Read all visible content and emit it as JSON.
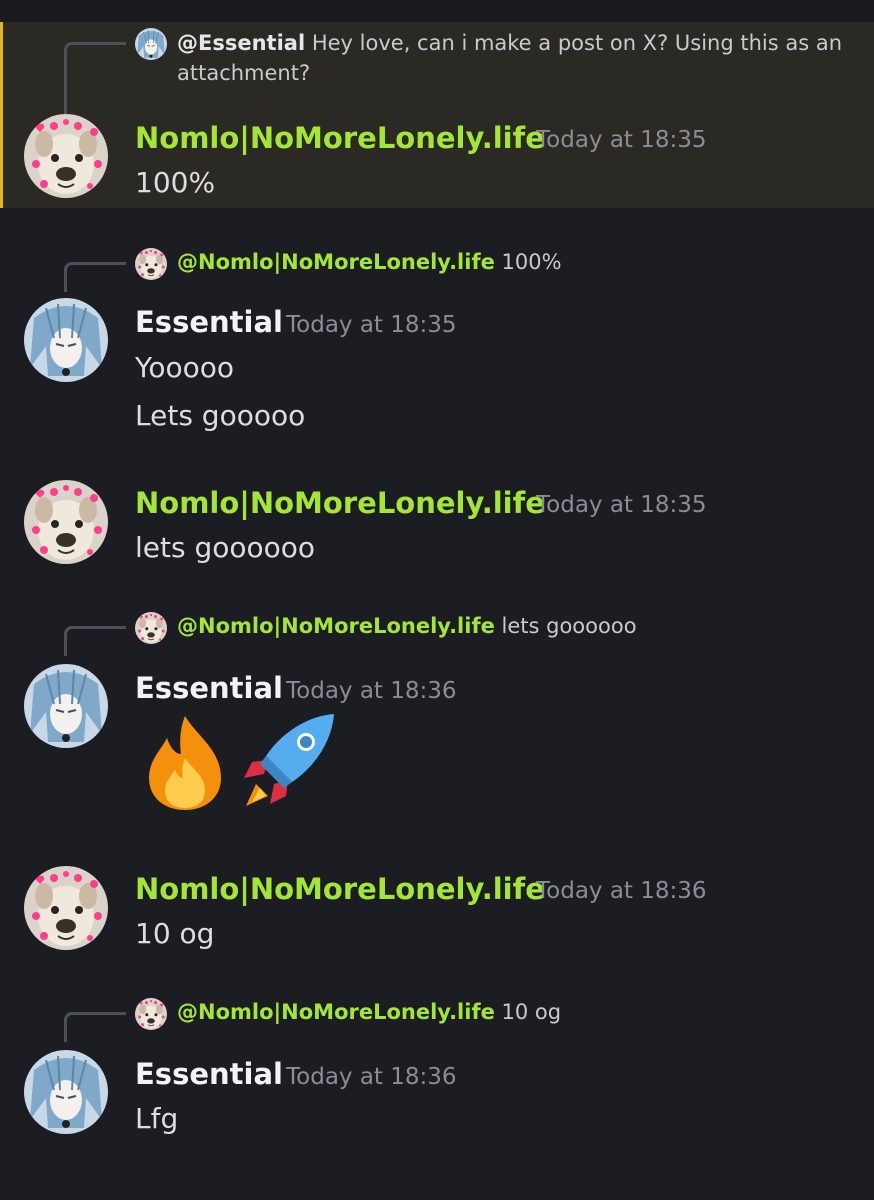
{
  "colors": {
    "background": "#1c1d22",
    "highlight_background": "#2b2924",
    "highlight_border": "#e6b422",
    "username_green": "#a3e635",
    "username_white": "#f2f3f5",
    "timestamp": "#8b8d95",
    "message_text": "#dcdde1"
  },
  "messages": [
    {
      "reply": {
        "avatar": "anime-avatar",
        "mention": "@Essential",
        "text": "Hey love, can i make a post on X? Using this as an attachment?"
      },
      "avatar": "dog-hearts-avatar",
      "author": "Nomlo|NoMoreLonely.life",
      "timestamp": "Today at 18:35",
      "lines": [
        "100%"
      ]
    },
    {
      "reply": {
        "avatar": "dog-hearts-avatar",
        "mention": "@Nomlo|NoMoreLonely.life",
        "text": "100%"
      },
      "avatar": "anime-avatar",
      "author": "Essential",
      "timestamp": "Today at 18:35",
      "lines": [
        "Yooooo",
        "Lets gooooo"
      ]
    },
    {
      "avatar": "dog-hearts-avatar",
      "author": "Nomlo|NoMoreLonely.life",
      "timestamp": "Today at 18:35",
      "lines": [
        "lets goooooo"
      ]
    },
    {
      "reply": {
        "avatar": "dog-hearts-avatar",
        "mention": "@Nomlo|NoMoreLonely.life",
        "text": "lets goooooo"
      },
      "avatar": "anime-avatar",
      "author": "Essential",
      "timestamp": "Today at 18:36",
      "emojis": [
        "fire-emoji",
        "rocket-emoji"
      ]
    },
    {
      "avatar": "dog-hearts-avatar",
      "author": "Nomlo|NoMoreLonely.life",
      "timestamp": "Today at 18:36",
      "lines": [
        "10 og"
      ]
    },
    {
      "reply": {
        "avatar": "dog-hearts-avatar",
        "mention": "@Nomlo|NoMoreLonely.life",
        "text": "10 og"
      },
      "avatar": "anime-avatar",
      "author": "Essential",
      "timestamp": "Today at 18:36",
      "lines": [
        "Lfg"
      ]
    }
  ]
}
